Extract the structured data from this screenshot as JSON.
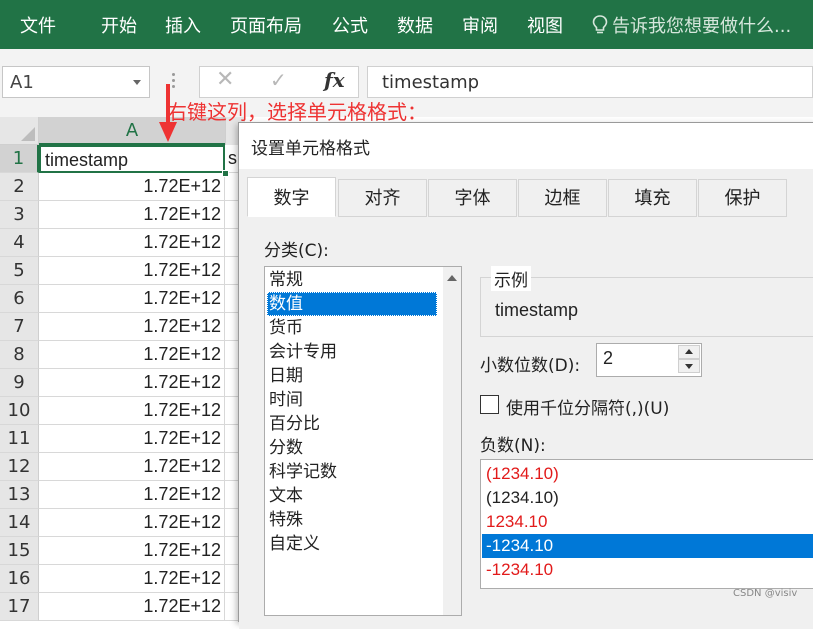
{
  "ribbon": {
    "tabs": [
      "文件",
      "开始",
      "插入",
      "页面布局",
      "公式",
      "数据",
      "审阅",
      "视图"
    ],
    "tell_me": "告诉我您想要做什么..."
  },
  "formula_bar": {
    "name_box": "A1",
    "formula_value": "timestamp",
    "fx_label": "fx"
  },
  "sheet": {
    "column_a": "A",
    "rows": [
      "1",
      "2",
      "3",
      "4",
      "5",
      "6",
      "7",
      "8",
      "9",
      "10",
      "11",
      "12",
      "13",
      "14",
      "15",
      "16",
      "17"
    ],
    "a1": "timestamp",
    "b1_partial": "s",
    "values": [
      "1.72E+12",
      "1.72E+12",
      "1.72E+12",
      "1.72E+12",
      "1.72E+12",
      "1.72E+12",
      "1.72E+12",
      "1.72E+12",
      "1.72E+12",
      "1.72E+12",
      "1.72E+12",
      "1.72E+12",
      "1.72E+12",
      "1.72E+12",
      "1.72E+12",
      "1.72E+12"
    ]
  },
  "annotation": {
    "text": "右键这列，选择单元格格式：",
    "color": "#ee3333"
  },
  "dialog": {
    "title": "设置单元格格式",
    "tabs": [
      "数字",
      "对齐",
      "字体",
      "边框",
      "填充",
      "保护"
    ],
    "active_tab": "数字",
    "category_label": "分类(C):",
    "categories": [
      "常规",
      "数值",
      "货币",
      "会计专用",
      "日期",
      "时间",
      "百分比",
      "分数",
      "科学记数",
      "文本",
      "特殊",
      "自定义"
    ],
    "selected_category": "数值",
    "sample_label": "示例",
    "sample_value": "timestamp",
    "decimal_label": "小数位数(D):",
    "decimal_value": "2",
    "thousands_label": "使用千位分隔符(,)(U)",
    "thousands_checked": false,
    "negative_label": "负数(N):",
    "negative_options": [
      "(1234.10)",
      "(1234.10)",
      "1234.10",
      "-1234.10",
      "-1234.10"
    ],
    "selected_negative": "-1234.10"
  },
  "watermark": "CSDN @visiv",
  "colors": {
    "excel_green": "#217346",
    "selection_blue": "#0078d7",
    "negative_red": "#e21a1a"
  }
}
